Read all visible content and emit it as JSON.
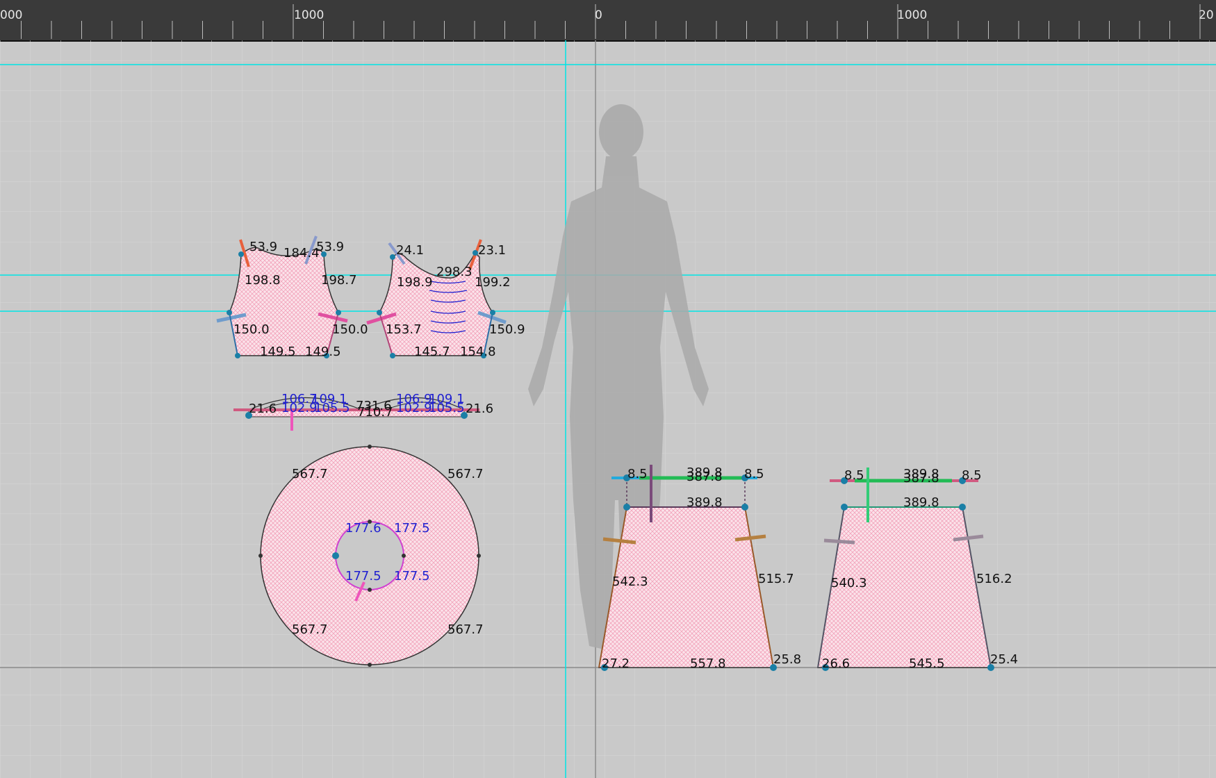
{
  "ruler": {
    "labels": [
      "000",
      "1000",
      "0",
      "1000",
      "20"
    ]
  },
  "colors": {
    "background": "#c9c9c9",
    "grid": "#d8d8d8",
    "guide": "#00e5e5",
    "fabric": "#f6c9d6",
    "ruler_bg": "#3a3a3a",
    "outline": "#333333",
    "point": "#1a7fa6"
  },
  "icons": {
    "avatar": "avatar-silhouette-icon"
  },
  "pieces": {
    "bodice_front": {
      "labels": [
        "53.9",
        "184.4",
        "53.9",
        "198.8",
        "198.7",
        "150.0",
        "150.0",
        "149.5",
        "149.5"
      ]
    },
    "bodice_back": {
      "labels": [
        "24.1",
        "23.1",
        "298.3",
        "198.9",
        "199.2",
        "153.7",
        "150.9",
        "145.7",
        "154.8"
      ]
    },
    "waistband": {
      "labels": [
        "21.6",
        "106.7",
        "102.9",
        "109.1",
        "105.5",
        "731.6",
        "710.7",
        "106.9",
        "102.9",
        "109.1",
        "105.5",
        "21.6"
      ]
    },
    "circle_skirt": {
      "outer_labels": [
        "567.7",
        "567.7",
        "567.7",
        "567.7"
      ],
      "inner_labels": [
        "177.6",
        "177.5",
        "177.5",
        "177.5"
      ]
    },
    "skirt_front": {
      "labels": [
        "8.5",
        "389.8",
        "387.8",
        "8.5",
        "389.8",
        "542.3",
        "515.7",
        "27.2",
        "557.8",
        "25.8"
      ]
    },
    "skirt_back": {
      "labels": [
        "8.5",
        "389.8",
        "387.8",
        "8.5",
        "389.8",
        "540.3",
        "516.2",
        "26.6",
        "545.5",
        "25.4"
      ]
    }
  }
}
